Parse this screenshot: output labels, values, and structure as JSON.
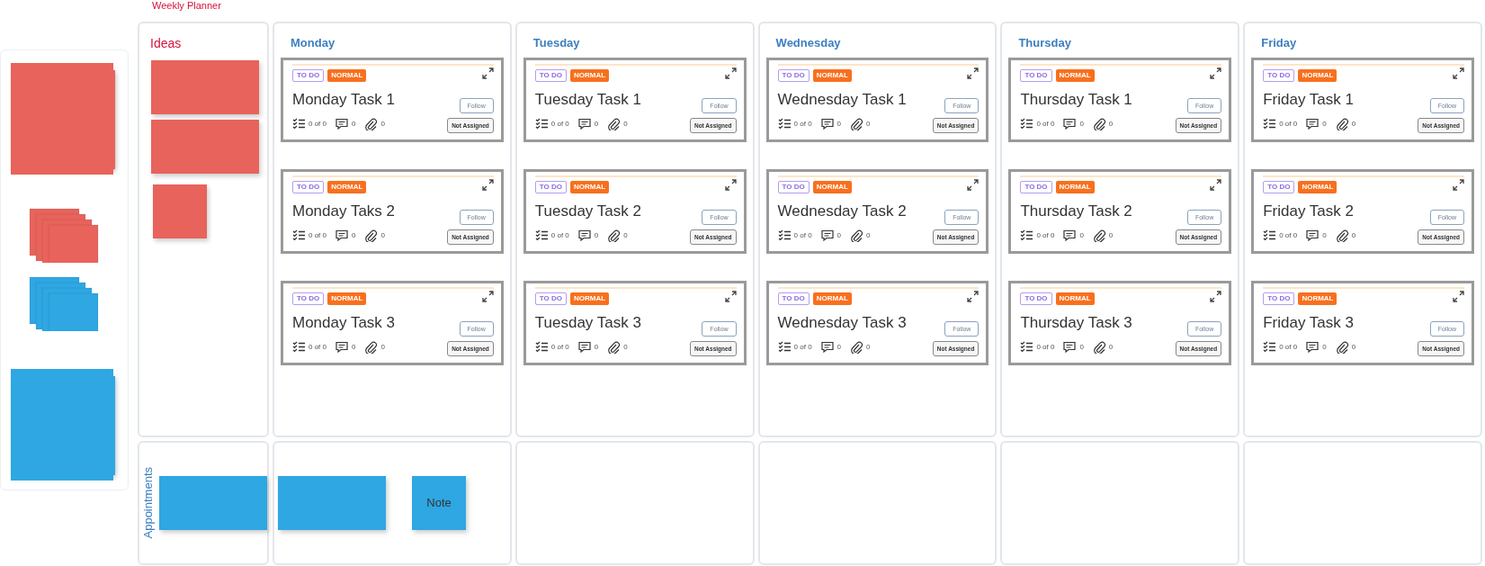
{
  "title": "Weekly Planner",
  "palette": [
    {
      "kind": "large",
      "color": "#e8635b"
    },
    {
      "kind": "small",
      "color": "#e8635b"
    },
    {
      "kind": "small",
      "color": "#2ea7e2"
    },
    {
      "kind": "large",
      "color": "#2ea7e2"
    }
  ],
  "ideas": {
    "label": "Ideas",
    "notes": [
      {
        "kind": "wide"
      },
      {
        "kind": "wide"
      },
      {
        "kind": "square"
      }
    ]
  },
  "days": [
    {
      "name": "Monday",
      "tasks": [
        {
          "status": "TO DO",
          "priority": "NORMAL",
          "title": "Monday Task 1",
          "checklist": "0 of 0",
          "comments": "0",
          "attachments": "0",
          "follow": "Follow",
          "assignee": "Not Assigned"
        },
        {
          "status": "TO DO",
          "priority": "NORMAL",
          "title": "Monday Taks 2",
          "checklist": "0 of 0",
          "comments": "0",
          "attachments": "0",
          "follow": "Follow",
          "assignee": "Not Assigned"
        },
        {
          "status": "TO DO",
          "priority": "NORMAL",
          "title": "Monday Task 3",
          "checklist": "0 of 0",
          "comments": "0",
          "attachments": "0",
          "follow": "Follow",
          "assignee": "Not Assigned"
        }
      ]
    },
    {
      "name": "Tuesday",
      "tasks": [
        {
          "status": "TO DO",
          "priority": "NORMAL",
          "title": "Tuesday Task 1",
          "checklist": "0 of 0",
          "comments": "0",
          "attachments": "0",
          "follow": "Follow",
          "assignee": "Not Assigned"
        },
        {
          "status": "TO DO",
          "priority": "NORMAL",
          "title": "Tuesday Task 2",
          "checklist": "0 of 0",
          "comments": "0",
          "attachments": "0",
          "follow": "Follow",
          "assignee": "Not Assigned"
        },
        {
          "status": "TO DO",
          "priority": "NORMAL",
          "title": "Tuesday Task 3",
          "checklist": "0 of 0",
          "comments": "0",
          "attachments": "0",
          "follow": "Follow",
          "assignee": "Not Assigned"
        }
      ]
    },
    {
      "name": "Wednesday",
      "tasks": [
        {
          "status": "TO DO",
          "priority": "NORMAL",
          "title": "Wednesday Task 1",
          "checklist": "0 of 0",
          "comments": "0",
          "attachments": "0",
          "follow": "Follow",
          "assignee": "Not Assigned"
        },
        {
          "status": "TO DO",
          "priority": "NORMAL",
          "title": "Wednesday Task 2",
          "checklist": "0 of 0",
          "comments": "0",
          "attachments": "0",
          "follow": "Follow",
          "assignee": "Not Assigned"
        },
        {
          "status": "TO DO",
          "priority": "NORMAL",
          "title": "Wednesday Task 3",
          "checklist": "0 of 0",
          "comments": "0",
          "attachments": "0",
          "follow": "Follow",
          "assignee": "Not Assigned"
        }
      ]
    },
    {
      "name": "Thursday",
      "tasks": [
        {
          "status": "TO DO",
          "priority": "NORMAL",
          "title": "Thursday Task 1",
          "checklist": "0 of 0",
          "comments": "0",
          "attachments": "0",
          "follow": "Follow",
          "assignee": "Not Assigned"
        },
        {
          "status": "TO DO",
          "priority": "NORMAL",
          "title": "Thursday Task 2",
          "checklist": "0 of 0",
          "comments": "0",
          "attachments": "0",
          "follow": "Follow",
          "assignee": "Not Assigned"
        },
        {
          "status": "TO DO",
          "priority": "NORMAL",
          "title": "Thursday Task 3",
          "checklist": "0 of 0",
          "comments": "0",
          "attachments": "0",
          "follow": "Follow",
          "assignee": "Not Assigned"
        }
      ]
    },
    {
      "name": "Friday",
      "tasks": [
        {
          "status": "TO DO",
          "priority": "NORMAL",
          "title": "Friday Task 1",
          "checklist": "0 of 0",
          "comments": "0",
          "attachments": "0",
          "follow": "Follow",
          "assignee": "Not Assigned"
        },
        {
          "status": "TO DO",
          "priority": "NORMAL",
          "title": "Friday Task 2",
          "checklist": "0 of 0",
          "comments": "0",
          "attachments": "0",
          "follow": "Follow",
          "assignee": "Not Assigned"
        },
        {
          "status": "TO DO",
          "priority": "NORMAL",
          "title": "Friday Task 3",
          "checklist": "0 of 0",
          "comments": "0",
          "attachments": "0",
          "follow": "Follow",
          "assignee": "Not Assigned"
        }
      ]
    }
  ],
  "appointments": {
    "label": "Appointments",
    "cells": [
      {
        "notes": [
          {
            "kind": "wide"
          }
        ]
      },
      {
        "notes": [
          {
            "kind": "wide"
          },
          {
            "kind": "square",
            "text": "Note"
          }
        ]
      }
    ]
  }
}
